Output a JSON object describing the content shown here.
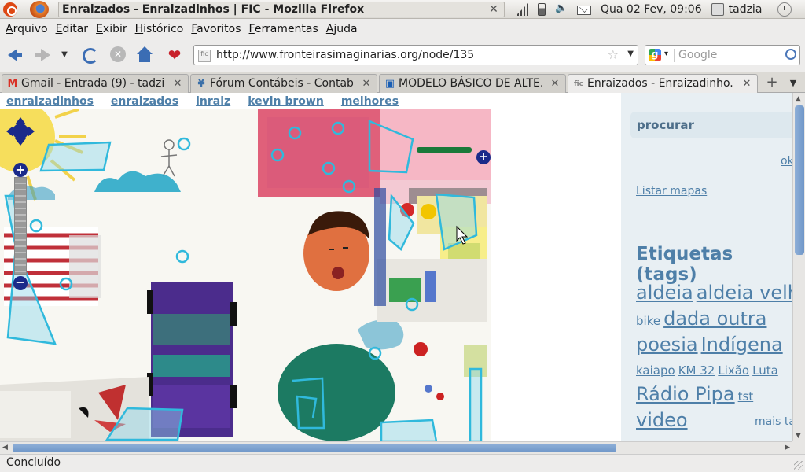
{
  "window": {
    "title": "Enraizados - Enraizadinhos | FIC - Mozilla Firefox",
    "clock": "Qua 02 Fev, 09:06",
    "user": "tadzia"
  },
  "menu": [
    "Arquivo",
    "Editar",
    "Exibir",
    "Histórico",
    "Favoritos",
    "Ferramentas",
    "Ajuda"
  ],
  "urlbar": {
    "url": "http://www.fronteirasimaginarias.org/node/135"
  },
  "searchbar": {
    "placeholder": "Google"
  },
  "tabs": [
    {
      "label": "Gmail - Entrada (9) - tadzi...",
      "favicon": "gmail-icon"
    },
    {
      "label": "Fórum Contábeis - Contab...",
      "favicon": "forum-icon"
    },
    {
      "label": "MODELO BÁSICO DE ALTE...",
      "favicon": "doc-icon"
    },
    {
      "label": "Enraizados - Enraizadinho...",
      "favicon": "fic-icon",
      "active": true
    }
  ],
  "page": {
    "nav_links": [
      "enraizadinhos",
      "enraizados",
      "inraiz",
      "kevin brown",
      "melhores"
    ],
    "search_title": "procurar",
    "ok_label": "ok",
    "listar_mapas": "Listar mapas",
    "tags_heading": "Etiquetas (tags)",
    "tags": [
      {
        "label": "aldeia",
        "size": 24
      },
      {
        "label": "aldeia velha",
        "size": 24
      },
      {
        "label": "bike",
        "size": 15
      },
      {
        "label": "dada outra",
        "size": 24
      },
      {
        "label": "poesia",
        "size": 24
      },
      {
        "label": "Indígena",
        "size": 24
      },
      {
        "label": "kaiapo",
        "size": 15
      },
      {
        "label": "KM 32",
        "size": 15
      },
      {
        "label": "Lixão",
        "size": 15
      },
      {
        "label": "Luta",
        "size": 15
      },
      {
        "label": "Rádio Pipa",
        "size": 24
      },
      {
        "label": "tst",
        "size": 15
      },
      {
        "label": "video",
        "size": 24
      }
    ],
    "more_tags": "mais tags"
  },
  "status": {
    "text": "Concluído"
  },
  "colors": {
    "link": "#4e7fa8",
    "overlay": "#30b9dc"
  }
}
